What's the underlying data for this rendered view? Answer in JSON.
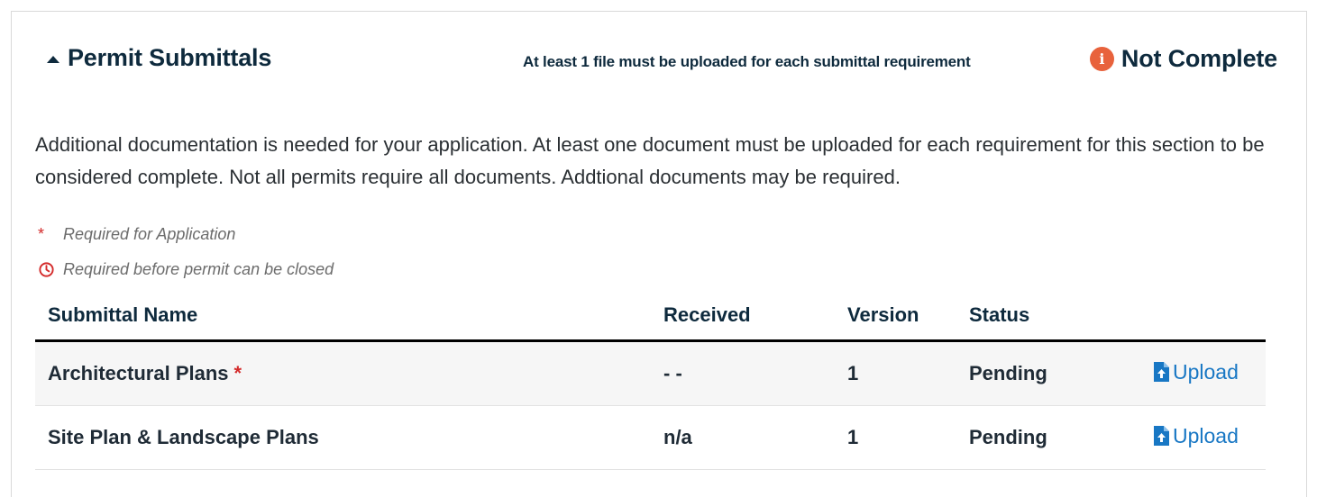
{
  "section": {
    "title": "Permit Submittals",
    "note": "At least 1 file must be uploaded for each submittal requirement",
    "status": "Not Complete",
    "status_icon": "info-icon",
    "status_color": "#e8623c"
  },
  "description": "Additional documentation is needed for your application. At least one document must be uploaded for each requirement for this section to be considered complete. Not all permits require all documents. Addtional documents may be required.",
  "legend": {
    "required_symbol": "*",
    "required_label": "Required for Application",
    "closed_icon": "clock-icon",
    "closed_label": "Required before permit can be closed"
  },
  "table": {
    "columns": [
      "Submittal Name",
      "Received",
      "Version",
      "Status",
      ""
    ],
    "rows": [
      {
        "name": "Architectural Plans",
        "required": "*",
        "received": "- -",
        "version": "1",
        "status": "Pending",
        "action": "Upload"
      },
      {
        "name": "Site Plan & Landscape Plans",
        "required": "",
        "received": "n/a",
        "version": "1",
        "status": "Pending",
        "action": "Upload"
      }
    ]
  },
  "colors": {
    "accent_link": "#1877c4",
    "required_red": "#d42b2b",
    "heading_navy": "#0e2a3d"
  }
}
